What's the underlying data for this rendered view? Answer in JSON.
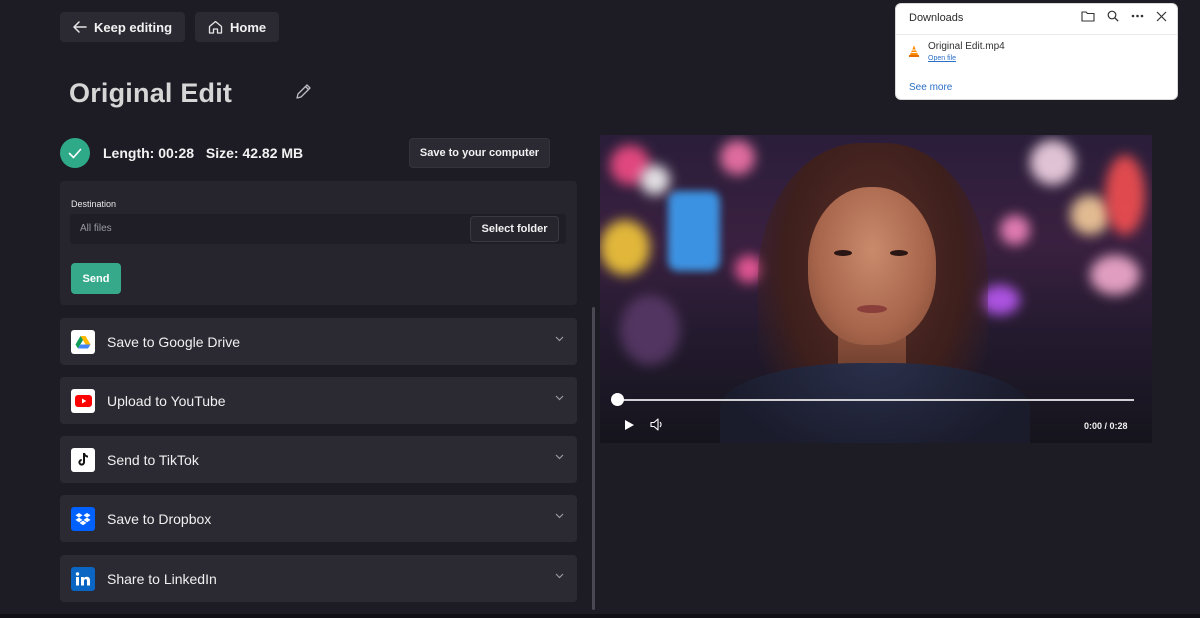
{
  "top_bar": {
    "keep_editing_label": "Keep editing",
    "home_label": "Home"
  },
  "project": {
    "title": "Original Edit"
  },
  "export_info": {
    "length_text": "Length: 00:28",
    "size_text": "Size: 42.82 MB",
    "save_computer_label": "Save to your computer"
  },
  "destination": {
    "label": "Destination",
    "placeholder": "All files",
    "select_folder_label": "Select folder",
    "send_label": "Send"
  },
  "share_options": [
    {
      "label": "Save to Google Drive",
      "icon": "google-drive-icon"
    },
    {
      "label": "Upload to YouTube",
      "icon": "youtube-icon"
    },
    {
      "label": "Send to TikTok",
      "icon": "tiktok-icon"
    },
    {
      "label": "Save to Dropbox",
      "icon": "dropbox-icon"
    },
    {
      "label": "Share to LinkedIn",
      "icon": "linkedin-icon"
    }
  ],
  "player": {
    "time_text": "0:00 / 0:28",
    "progress": 0
  },
  "downloads_panel": {
    "title": "Downloads",
    "file_name": "Original Edit.mp4",
    "open_file_label": "Open file",
    "see_more_label": "See more"
  },
  "colors": {
    "background": "#1d1c24",
    "panel": "#2b2a33",
    "accent_green": "#35a98a",
    "link_blue": "#2b6fc6"
  }
}
